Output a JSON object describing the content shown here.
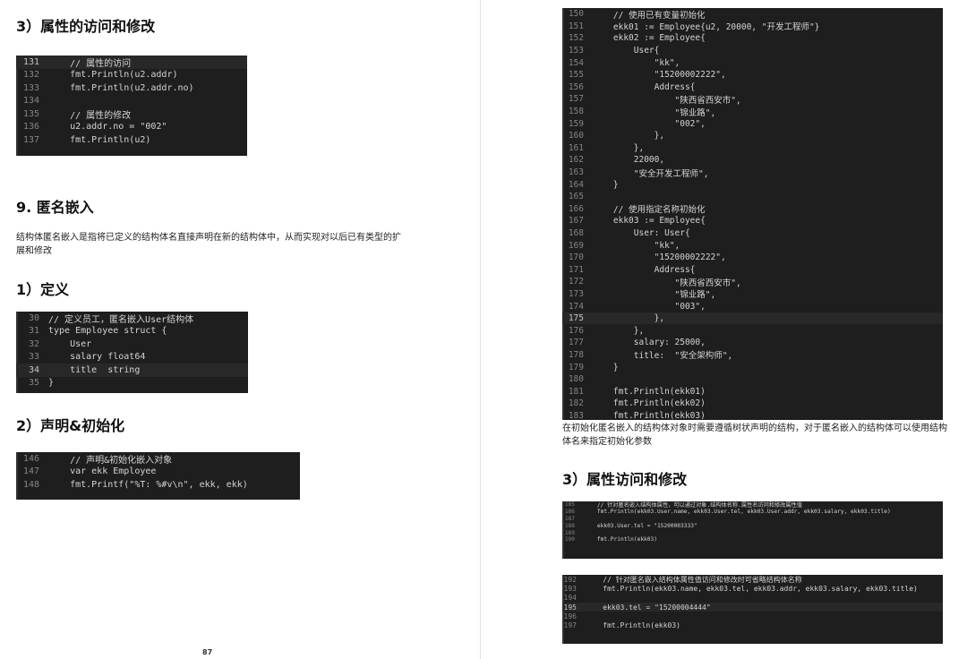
{
  "left": {
    "heading_attr": "3）属性的访问和修改",
    "code_attr": [
      {
        "n": "131",
        "t": "    // 属性的访问"
      },
      {
        "n": "132",
        "t": "    fmt.Println(u2.addr)"
      },
      {
        "n": "133",
        "t": "    fmt.Println(u2.addr.no)"
      },
      {
        "n": "134",
        "t": ""
      },
      {
        "n": "135",
        "t": "    // 属性的修改"
      },
      {
        "n": "136",
        "t": "    u2.addr.no = \"002\""
      },
      {
        "n": "137",
        "t": "    fmt.Println(u2)"
      }
    ],
    "heading_anon": "9. 匿名嵌入",
    "para_anon": "结构体匿名嵌入是指将已定义的结构体名直接声明在新的结构体中，从而实现对以后已有类型的扩展和修改",
    "heading_def": "1）定义",
    "code_def": [
      {
        "n": "30",
        "t": "// 定义员工，匿名嵌入User结构体"
      },
      {
        "n": "31",
        "t": "type Employee struct {"
      },
      {
        "n": "32",
        "t": "    User"
      },
      {
        "n": "33",
        "t": "    salary float64"
      },
      {
        "n": "34",
        "t": "    title  string"
      },
      {
        "n": "35",
        "t": "}"
      }
    ],
    "heading_decl": "2）声明&初始化",
    "code_decl": [
      {
        "n": "146",
        "t": "    // 声明&初始化嵌入对象"
      },
      {
        "n": "147",
        "t": "    var ekk Employee"
      },
      {
        "n": "148",
        "t": "    fmt.Printf(\"%T: %#v\\n\", ekk, ekk)"
      }
    ],
    "page_number": "87"
  },
  "right": {
    "code_init": [
      {
        "n": "150",
        "t": "    // 使用已有变量初始化"
      },
      {
        "n": "151",
        "t": "    ekk01 := Employee{u2, 20000, \"开发工程师\"}"
      },
      {
        "n": "152",
        "t": "    ekk02 := Employee{"
      },
      {
        "n": "153",
        "t": "        User{"
      },
      {
        "n": "154",
        "t": "            \"kk\","
      },
      {
        "n": "155",
        "t": "            \"15200002222\","
      },
      {
        "n": "156",
        "t": "            Address{"
      },
      {
        "n": "157",
        "t": "                \"陕西省西安市\","
      },
      {
        "n": "158",
        "t": "                \"锦业路\","
      },
      {
        "n": "159",
        "t": "                \"002\","
      },
      {
        "n": "160",
        "t": "            },"
      },
      {
        "n": "161",
        "t": "        },"
      },
      {
        "n": "162",
        "t": "        22000,"
      },
      {
        "n": "163",
        "t": "        \"安全开发工程师\","
      },
      {
        "n": "164",
        "t": "    }"
      },
      {
        "n": "165",
        "t": ""
      },
      {
        "n": "166",
        "t": "    // 使用指定名称初始化"
      },
      {
        "n": "167",
        "t": "    ekk03 := Employee{"
      },
      {
        "n": "168",
        "t": "        User: User{"
      },
      {
        "n": "169",
        "t": "            \"kk\","
      },
      {
        "n": "170",
        "t": "            \"15200002222\","
      },
      {
        "n": "171",
        "t": "            Address{"
      },
      {
        "n": "172",
        "t": "                \"陕西省西安市\","
      },
      {
        "n": "173",
        "t": "                \"锦业路\","
      },
      {
        "n": "174",
        "t": "                \"003\","
      },
      {
        "n": "175",
        "t": "            },"
      },
      {
        "n": "176",
        "t": "        },"
      },
      {
        "n": "177",
        "t": "        salary: 25000,"
      },
      {
        "n": "178",
        "t": "        title:  \"安全架构师\","
      },
      {
        "n": "179",
        "t": "    }"
      },
      {
        "n": "180",
        "t": ""
      },
      {
        "n": "181",
        "t": "    fmt.Println(ekk01)"
      },
      {
        "n": "182",
        "t": "    fmt.Println(ekk02)"
      },
      {
        "n": "183",
        "t": "    fmt.Println(ekk03)"
      }
    ],
    "para_init": "在初始化匿名嵌入的结构体对象时需要遵循树状声明的结构，对于匿名嵌入的结构体可以使用结构体名来指定初始化参数",
    "heading_attr": "3）属性访问和修改",
    "code_mod1": [
      {
        "n": "185",
        "t": "    // 针对匿名嵌入结构体属性，可以通过对象.结构体名称.属性名访问和修改属性值"
      },
      {
        "n": "186",
        "t": "    fmt.Println(ekk03.User.name, ekk03.User.tel, ekk03.User.addr, ekk03.salary, ekk03.title)"
      },
      {
        "n": "187",
        "t": ""
      },
      {
        "n": "188",
        "t": "    ekk03.User.tel = \"15200003333\""
      },
      {
        "n": "189",
        "t": ""
      },
      {
        "n": "190",
        "t": "    fmt.Println(ekk03)"
      }
    ],
    "code_mod2": [
      {
        "n": "192",
        "t": "    // 针对匿名嵌入结构体属性值访问和修改时可省略结构体名称"
      },
      {
        "n": "193",
        "t": "    fmt.Println(ekk03.name, ekk03.tel, ekk03.addr, ekk03.salary, ekk03.title)"
      },
      {
        "n": "194",
        "t": ""
      },
      {
        "n": "195",
        "t": "    ekk03.tel = \"15200004444\""
      },
      {
        "n": "196",
        "t": ""
      },
      {
        "n": "197",
        "t": "    fmt.Println(ekk03)"
      }
    ]
  }
}
